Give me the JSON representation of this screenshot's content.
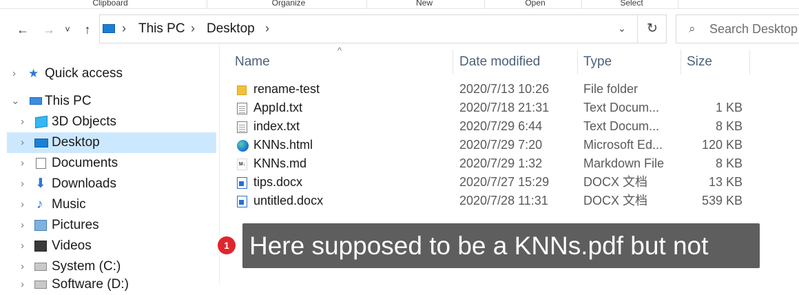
{
  "ribbon": {
    "groups": [
      "Clipboard",
      "Organize",
      "New",
      "Open",
      "Select"
    ]
  },
  "nav_buttons": {
    "back": "←",
    "forward": "→",
    "recent": "˅",
    "up": "↑"
  },
  "address": {
    "crumbs": [
      "This PC",
      "Desktop"
    ],
    "separator": "›",
    "dropdown": "⌄",
    "refresh": "↻"
  },
  "search": {
    "placeholder": "Search Desktop",
    "icon": "⌕"
  },
  "sidebar": {
    "collapsed_glyph": "›",
    "expanded_glyph": "⌄",
    "items": [
      {
        "label": "Quick access",
        "icon": "star-icon"
      },
      {
        "label": "This PC",
        "icon": "computer-icon"
      },
      {
        "label": "3D Objects",
        "icon": "3d-objects-icon"
      },
      {
        "label": "Desktop",
        "icon": "desktop-icon",
        "selected": true
      },
      {
        "label": "Documents",
        "icon": "documents-icon"
      },
      {
        "label": "Downloads",
        "icon": "downloads-icon"
      },
      {
        "label": "Music",
        "icon": "music-icon"
      },
      {
        "label": "Pictures",
        "icon": "pictures-icon"
      },
      {
        "label": "Videos",
        "icon": "videos-icon"
      },
      {
        "label": "System (C:)",
        "icon": "drive-icon"
      },
      {
        "label": "Software (D:)",
        "icon": "drive-icon"
      }
    ],
    "star_glyph": "★",
    "download_glyph": "⬇",
    "music_glyph": "♪"
  },
  "columns": {
    "name": "Name",
    "date": "Date modified",
    "type": "Type",
    "size": "Size",
    "sort_glyph": "^"
  },
  "files": [
    {
      "name": "rename-test",
      "date": "2020/7/13 10:26",
      "type": "File folder",
      "size": "",
      "icon": "folder-icon"
    },
    {
      "name": "AppId.txt",
      "date": "2020/7/18 21:31",
      "type": "Text Docum...",
      "size": "1 KB",
      "icon": "text-file-icon"
    },
    {
      "name": "index.txt",
      "date": "2020/7/29 6:44",
      "type": "Text Docum...",
      "size": "8 KB",
      "icon": "text-file-icon"
    },
    {
      "name": "KNNs.html",
      "date": "2020/7/29 7:20",
      "type": "Microsoft Ed...",
      "size": "120 KB",
      "icon": "edge-icon"
    },
    {
      "name": "KNNs.md",
      "date": "2020/7/29 1:32",
      "type": "Markdown File",
      "size": "8 KB",
      "icon": "markdown-file-icon",
      "icon_text": "M↓"
    },
    {
      "name": "tips.docx",
      "date": "2020/7/27 15:29",
      "type": "DOCX 文档",
      "size": "13 KB",
      "icon": "word-doc-icon"
    },
    {
      "name": "untitled.docx",
      "date": "2020/7/28 11:31",
      "type": "DOCX 文档",
      "size": "539 KB",
      "icon": "word-doc-icon"
    }
  ],
  "annotation": {
    "badge": "1",
    "text": "Here supposed to be a KNNs.pdf but not"
  },
  "colors": {
    "selection": "#cce8ff",
    "header_text": "#4c607a",
    "callout_bg": "#5e5e5e",
    "badge_bg": "#e0262c"
  }
}
